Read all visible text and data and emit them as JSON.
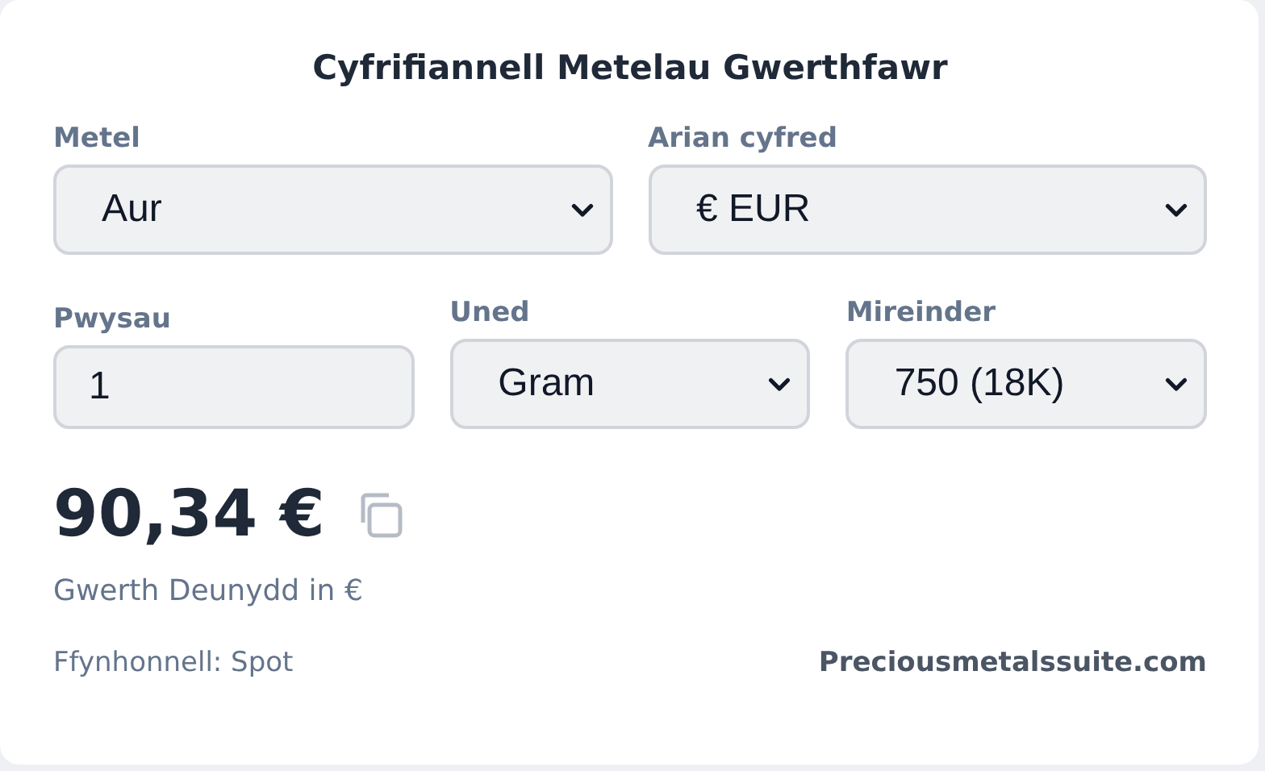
{
  "title": "Cyfrifiannell Metelau Gwerthfawr",
  "rows": [
    [
      {
        "kind": "select",
        "label": "Metel",
        "value": "Aur"
      },
      {
        "kind": "select",
        "label": "Arian cyfred",
        "value": "€ EUR"
      }
    ],
    [
      {
        "kind": "input",
        "label": "Pwysau",
        "value": "1"
      },
      {
        "kind": "select",
        "label": "Uned",
        "value": "Gram"
      },
      {
        "kind": "select",
        "label": "Mireinder",
        "value": "750 (18K)"
      }
    ]
  ],
  "result": {
    "value": "90,34 €",
    "caption": "Gwerth Deunydd in €"
  },
  "footer": {
    "source": "Ffynhonnell: Spot",
    "link": "Preciousmetalssuite.com"
  }
}
